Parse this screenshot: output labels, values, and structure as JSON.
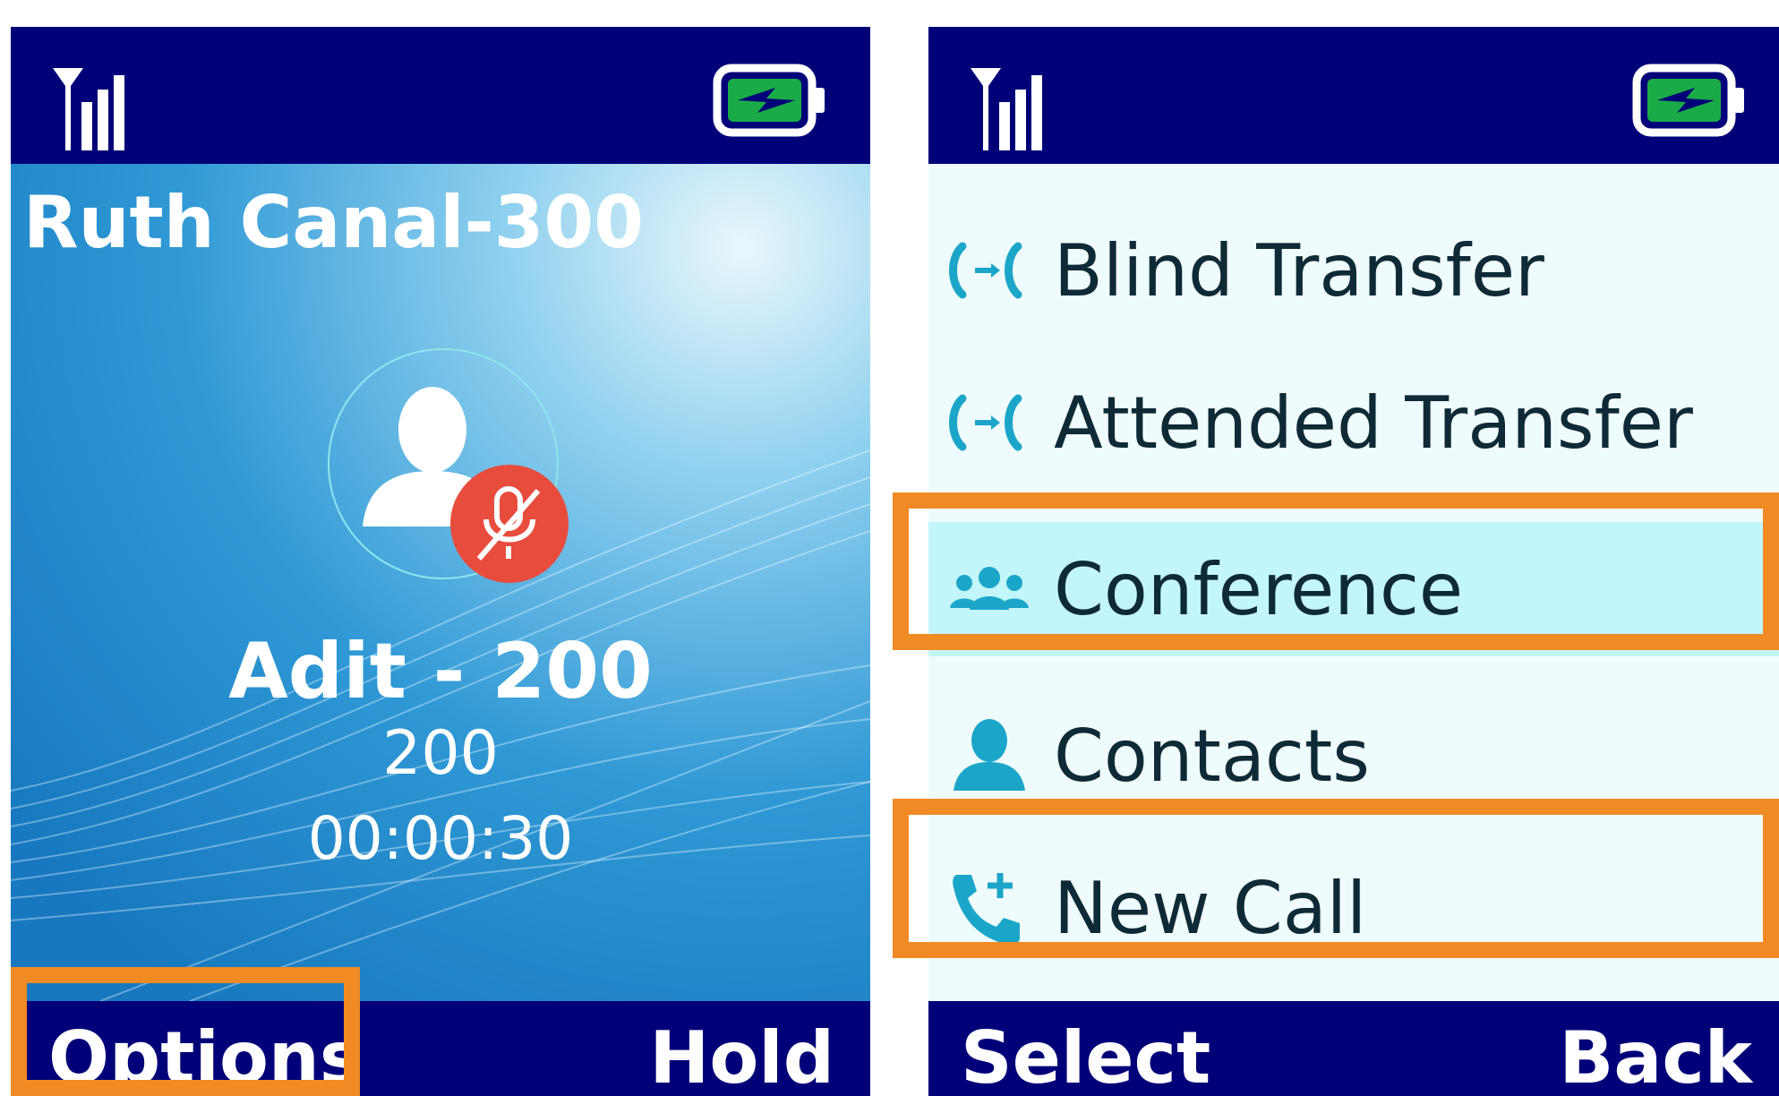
{
  "call_screen": {
    "caller_title": "Ruth Canal-300",
    "contact_name": "Adit - 200",
    "contact_number": "200",
    "timer": "00:00:30",
    "mic_state_icon": "mic-muted-icon",
    "softkeys": {
      "left": "Options",
      "right": "Hold"
    }
  },
  "options_menu": {
    "items": [
      {
        "label": "Blind Transfer",
        "icon": "call-transfer-icon"
      },
      {
        "label": "Attended Transfer",
        "icon": "call-transfer-icon"
      },
      {
        "label": "Conference",
        "icon": "group-icon",
        "selected": true
      },
      {
        "label": "Contacts",
        "icon": "person-icon"
      },
      {
        "label": "New Call",
        "icon": "phone-add-icon"
      }
    ],
    "softkeys": {
      "left": "Select",
      "right": "Back"
    }
  },
  "colors": {
    "status_bar": "#000078",
    "highlight": "#f08a24",
    "menu_bg": "#effcfd",
    "menu_selected": "#c3f6fb",
    "icon_accent": "#1ba6c9",
    "mute_badge": "#e84c3d",
    "battery_fill": "#1aaa48"
  }
}
